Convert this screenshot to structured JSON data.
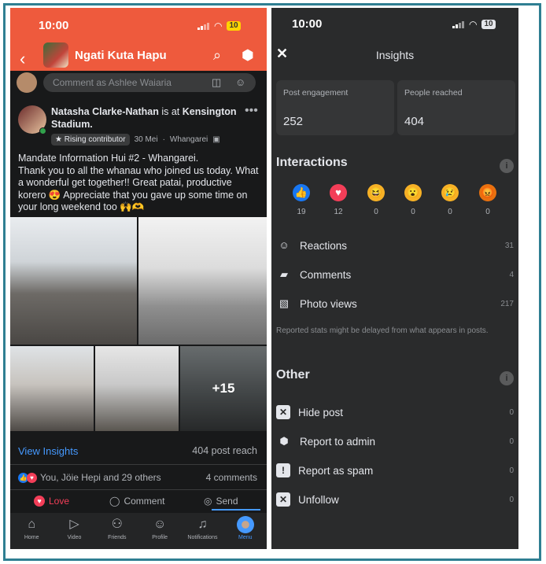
{
  "left_phone": {
    "status": {
      "time": "10:00",
      "battery": "10"
    },
    "header": {
      "group_name": "Ngati Kuta Hapu"
    },
    "comment_box": {
      "placeholder": "Comment as Ashlee Waiaria"
    },
    "post": {
      "author": "Natasha Clarke-Nathan",
      "at_text": "is at",
      "place": "Kensington Stadium.",
      "badge": "Rising contributor",
      "date": "30 Mei",
      "location": "Whangarei",
      "text": "Mandate Information Hui #2 - Whangarei.\nThank you to all the whanau who joined us today. What a wonderful get together!! Great patai, productive korero 😍 Appreciate that you gave up some time on your long weekend too 🙌🫶",
      "more_photos": "+15",
      "view_insights": "View Insights",
      "post_reach": "404 post reach",
      "reactors": "You, Jöie Hepi and 29 others",
      "comments": "4 comments"
    },
    "actions": {
      "love": "Love",
      "comment": "Comment",
      "send": "Send"
    },
    "tabbar": [
      {
        "label": "Home",
        "icon": "home-icon"
      },
      {
        "label": "Video",
        "icon": "video-icon"
      },
      {
        "label": "Friends",
        "icon": "friends-icon"
      },
      {
        "label": "Profile",
        "icon": "profile-icon"
      },
      {
        "label": "Notifications",
        "icon": "bell-icon"
      },
      {
        "label": "Menu",
        "icon": "menu-avatar-icon"
      }
    ]
  },
  "right_phone": {
    "status": {
      "time": "10:00",
      "battery": "10"
    },
    "title": "Insights",
    "cards": [
      {
        "label": "Post engagement",
        "value": "252"
      },
      {
        "label": "People reached",
        "value": "404"
      }
    ],
    "interactions": {
      "title": "Interactions",
      "reactions": [
        {
          "name": "like",
          "count": "19",
          "color": "#1877f2"
        },
        {
          "name": "love",
          "count": "12",
          "color": "#f33e58"
        },
        {
          "name": "haha",
          "count": "0",
          "color": "#f7b125"
        },
        {
          "name": "wow",
          "count": "0",
          "color": "#f7b125"
        },
        {
          "name": "sad",
          "count": "0",
          "color": "#f7b125"
        },
        {
          "name": "angry",
          "count": "0",
          "color": "#e9710f"
        }
      ],
      "rows": [
        {
          "label": "Reactions",
          "value": "31",
          "icon": "smile-icon"
        },
        {
          "label": "Comments",
          "value": "4",
          "icon": "comment-icon"
        },
        {
          "label": "Photo views",
          "value": "217",
          "icon": "photo-icon"
        }
      ],
      "note": "Reported stats might be delayed from what appears in posts."
    },
    "other": {
      "title": "Other",
      "rows": [
        {
          "label": "Hide post",
          "value": "0",
          "icon": "hide-icon"
        },
        {
          "label": "Report to admin",
          "value": "0",
          "icon": "report-admin-icon"
        },
        {
          "label": "Report as spam",
          "value": "0",
          "icon": "spam-icon"
        },
        {
          "label": "Unfollow",
          "value": "0",
          "icon": "unfollow-icon"
        }
      ]
    }
  }
}
